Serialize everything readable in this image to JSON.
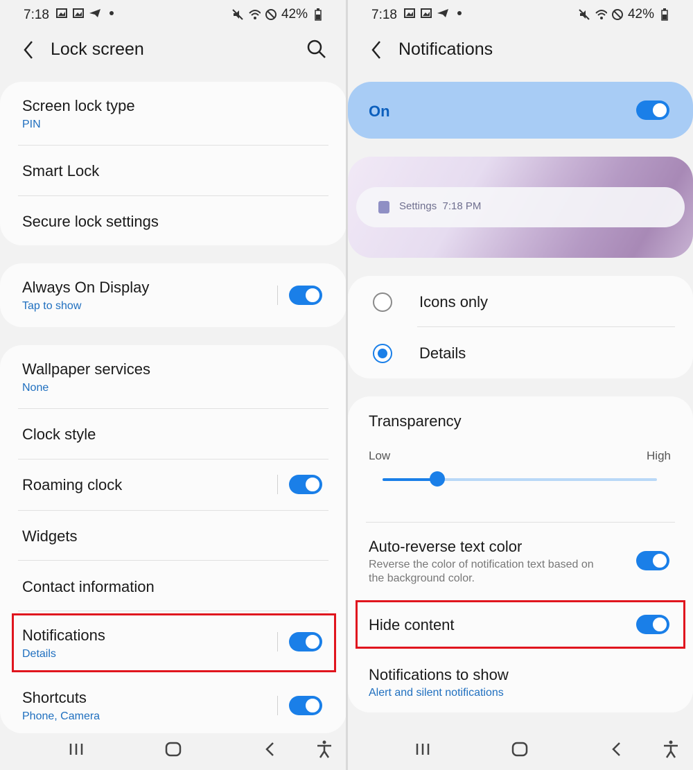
{
  "left": {
    "status": {
      "time": "7:18",
      "battery": "42%"
    },
    "appbar": {
      "title": "Lock screen"
    },
    "items": {
      "screen_lock_type": {
        "label": "Screen lock type",
        "value": "PIN"
      },
      "smart_lock": {
        "label": "Smart Lock"
      },
      "secure_lock": {
        "label": "Secure lock settings"
      },
      "aod": {
        "label": "Always On Display",
        "value": "Tap to show",
        "enabled": true
      },
      "wallpaper": {
        "label": "Wallpaper services",
        "value": "None"
      },
      "clock_style": {
        "label": "Clock style"
      },
      "roaming_clock": {
        "label": "Roaming clock",
        "enabled": true
      },
      "widgets": {
        "label": "Widgets"
      },
      "contact": {
        "label": "Contact information"
      },
      "notifications": {
        "label": "Notifications",
        "value": "Details",
        "enabled": true
      },
      "shortcuts": {
        "label": "Shortcuts",
        "value": "Phone, Camera",
        "enabled": true
      }
    }
  },
  "right": {
    "status": {
      "time": "7:18",
      "battery": "42%"
    },
    "appbar": {
      "title": "Notifications"
    },
    "master": {
      "label": "On",
      "enabled": true
    },
    "preview": {
      "app": "Settings",
      "time": "7:18 PM"
    },
    "style_options": [
      {
        "label": "Icons only",
        "selected": false
      },
      {
        "label": "Details",
        "selected": true
      }
    ],
    "transparency": {
      "label": "Transparency",
      "low": "Low",
      "high": "High",
      "value_fraction": 0.2
    },
    "auto_reverse": {
      "label": "Auto-reverse text color",
      "desc1": "Reverse the color of notification text based on",
      "desc2": "the background color.",
      "enabled": true
    },
    "hide_content": {
      "label": "Hide content",
      "enabled": true
    },
    "to_show": {
      "label": "Notifications to show",
      "value": "Alert and silent notifications"
    }
  },
  "colors": {
    "accent": "#1a7fe8",
    "highlight": "#e0151e",
    "link": "#1f6fbf"
  }
}
